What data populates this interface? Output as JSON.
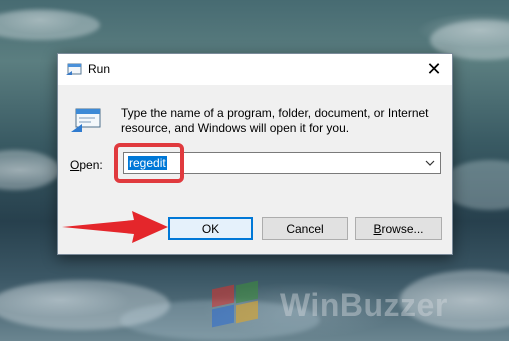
{
  "dialog": {
    "title": "Run",
    "description": "Type the name of a program, folder, document, or Internet resource, and Windows will open it for you.",
    "open_label_accel": "O",
    "open_label_rest": "pen:",
    "open_value": "regedit",
    "close_glyph": "✕",
    "buttons": {
      "ok": "OK",
      "cancel": "Cancel",
      "browse_accel": "B",
      "browse_rest": "rowse..."
    }
  },
  "watermark": {
    "text": "WinBuzzer"
  },
  "annotations": {
    "highlight_color": "#e03a3e",
    "arrow_color": "#e4262b"
  },
  "icons": {
    "title_icon": "run-icon",
    "body_icon": "run-icon",
    "close": "close-icon",
    "dropdown": "chevron-down-icon"
  },
  "colors": {
    "selection": "#0078d7",
    "ok_border": "#0078d7"
  }
}
